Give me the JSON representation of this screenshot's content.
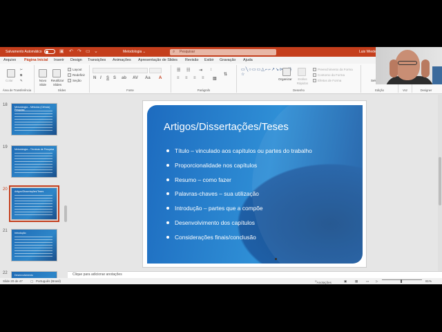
{
  "titlebar": {
    "autosave": "Salvamento Automático",
    "doc_title": "Metodologia",
    "doc_caret": "⌄",
    "search_placeholder": "Pesquisar",
    "user": "Luis Wieder"
  },
  "tabs": [
    "Arquivo",
    "Página Inicial",
    "Inserir",
    "Design",
    "Transições",
    "Animações",
    "Apresentação de Slides",
    "Revisão",
    "Exibir",
    "Gravação",
    "Ajuda"
  ],
  "ribbon": {
    "clipboard": {
      "label": "Área de Transferência",
      "paste": "Colar"
    },
    "slides": {
      "label": "Slides",
      "new_slide": "Novo Slide",
      "reuse": "Reutilizar Slides",
      "layout": "Layout",
      "reset": "Redefinir",
      "section": "Seção"
    },
    "font": {
      "label": "Fonte"
    },
    "paragraph": {
      "label": "Parágrafo"
    },
    "drawing": {
      "label": "Desenho",
      "arrange": "Organizar",
      "quick_styles": "Estilos Rápidos",
      "fill": "Preenchimento da Forma",
      "outline": "Contorno da Forma",
      "effects": "Efeitos de Forma"
    },
    "editing": {
      "label": "Edição",
      "select": "Selecionar"
    },
    "voice": {
      "label": "Voz"
    },
    "designer": {
      "label": "Designer"
    }
  },
  "thumbnails": [
    {
      "number": "18",
      "title": "Metodologia – Métodos (Ciência) Pesquisa"
    },
    {
      "number": "19",
      "title": "Metodologia – Técnicas de Pesquisa"
    },
    {
      "number": "20",
      "title": "Artigos/Dissertações/Teses"
    },
    {
      "number": "21",
      "title": "Introdução"
    },
    {
      "number": "22",
      "title": "Desenvolvimento"
    }
  ],
  "slide": {
    "title": "Artigos/Dissertações/Teses",
    "bullets": [
      "Título – vinculado aos capítulos ou partes do trabalho",
      "Proporcionalidade nos capítulos",
      "Resumo – como fazer",
      "Palavras-chaves – sua utilização",
      "Introdução – partes que a compõe",
      "Desenvolvimento dos capítulos",
      "Considerações finais/conclusão"
    ]
  },
  "notes_placeholder": "Clique para adicionar anotações",
  "status": {
    "slide_counter": "Slide 20 de 47",
    "language": "Português (Brasil)",
    "notes_button": "Anotações",
    "zoom": "81%"
  }
}
